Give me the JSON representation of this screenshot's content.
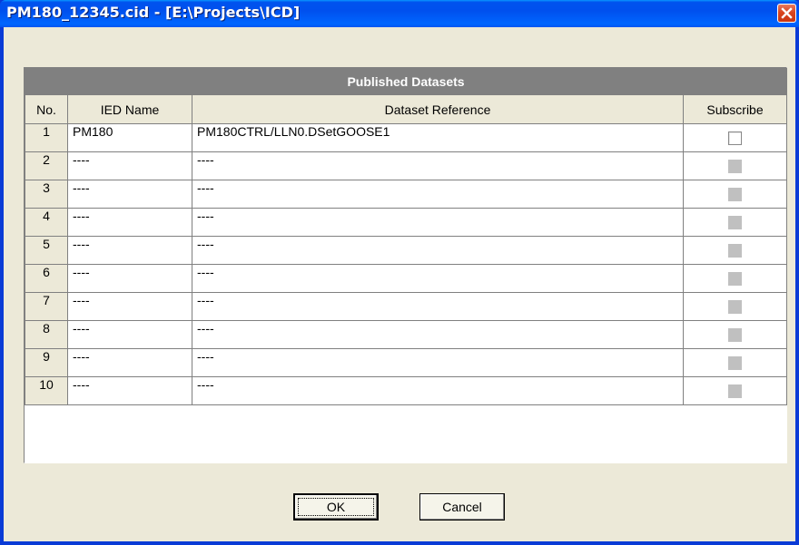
{
  "window": {
    "title": "PM180_12345.cid - [E:\\Projects\\ICD]"
  },
  "table": {
    "caption": "Published Datasets",
    "columns": [
      "No.",
      "IED Name",
      "Dataset Reference",
      "Subscribe"
    ],
    "rows": [
      {
        "no": "1",
        "ied_name": "PM180",
        "dataset_reference": "PM180CTRL/LLN0.DSetGOOSE1",
        "subscribe_enabled": true,
        "subscribe_checked": false
      },
      {
        "no": "2",
        "ied_name": "----",
        "dataset_reference": "----",
        "subscribe_enabled": false,
        "subscribe_checked": false
      },
      {
        "no": "3",
        "ied_name": "----",
        "dataset_reference": "----",
        "subscribe_enabled": false,
        "subscribe_checked": false
      },
      {
        "no": "4",
        "ied_name": "----",
        "dataset_reference": "----",
        "subscribe_enabled": false,
        "subscribe_checked": false
      },
      {
        "no": "5",
        "ied_name": "----",
        "dataset_reference": "----",
        "subscribe_enabled": false,
        "subscribe_checked": false
      },
      {
        "no": "6",
        "ied_name": "----",
        "dataset_reference": "----",
        "subscribe_enabled": false,
        "subscribe_checked": false
      },
      {
        "no": "7",
        "ied_name": "----",
        "dataset_reference": "----",
        "subscribe_enabled": false,
        "subscribe_checked": false
      },
      {
        "no": "8",
        "ied_name": "----",
        "dataset_reference": "----",
        "subscribe_enabled": false,
        "subscribe_checked": false
      },
      {
        "no": "9",
        "ied_name": "----",
        "dataset_reference": "----",
        "subscribe_enabled": false,
        "subscribe_checked": false
      },
      {
        "no": "10",
        "ied_name": "----",
        "dataset_reference": "----",
        "subscribe_enabled": false,
        "subscribe_checked": false
      }
    ]
  },
  "buttons": {
    "ok_label": "OK",
    "cancel_label": "Cancel"
  },
  "icons": {
    "close": "close-icon"
  },
  "colors": {
    "title_bar": "#0055ea",
    "close_button": "#d9451f",
    "dialog_background": "#ece9d8",
    "caption_background": "#808080"
  }
}
